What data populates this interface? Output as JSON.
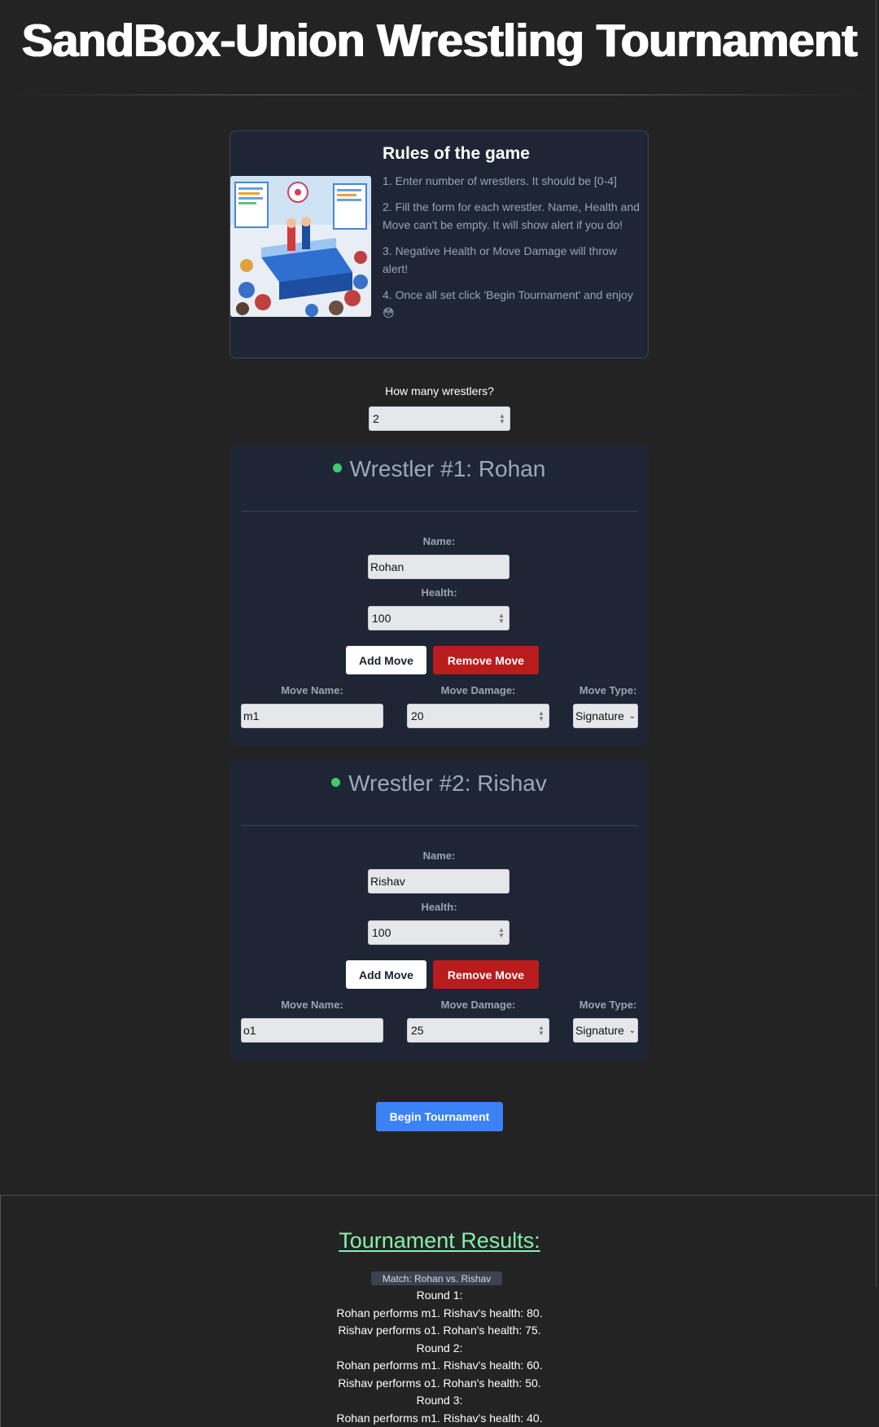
{
  "header": {
    "title": "SandBox-Union Wrestling Tournament"
  },
  "rules": {
    "title": "Rules of the game",
    "items": [
      "1. Enter number of wrestlers. It should be [0-4]",
      "2. Fill the form for each wrestler. Name, Health and Move can't be empty. It will show alert if you do!",
      "3. Negative Health or Move Damage will throw alert!",
      "4. Once all set click 'Begin Tournament' and enjoy 😳"
    ],
    "image_icon": "wrestling-ring-illustration"
  },
  "count": {
    "label": "How many wrestlers?",
    "value": "2"
  },
  "labels": {
    "name": "Name:",
    "health": "Health:",
    "add_move": "Add Move",
    "remove_move": "Remove Move",
    "move_name": "Move Name:",
    "move_damage": "Move Damage:",
    "move_type": "Move Type:"
  },
  "wrestlers": [
    {
      "title": "Wrestler #1: Rohan",
      "name": "Rohan",
      "health": "100",
      "move_name": "m1",
      "move_damage": "20",
      "move_type": "Signature"
    },
    {
      "title": "Wrestler #2: Rishav",
      "name": "Rishav",
      "health": "100",
      "move_name": "o1",
      "move_damage": "25",
      "move_type": "Signature"
    }
  ],
  "begin_label": "Begin Tournament",
  "results": {
    "title": "Tournament Results:",
    "match": "Match: Rohan vs. Rishav",
    "lines": [
      "Round 1:",
      "Rohan performs m1. Rishav's health: 80.",
      "Rishav performs o1. Rohan's health: 75.",
      "Round 2:",
      "Rohan performs m1. Rishav's health: 60.",
      "Rishav performs o1. Rohan's health: 50.",
      "Round 3:",
      "Rohan performs m1. Rishav's health: 40."
    ]
  },
  "colors": {
    "background": "#232323",
    "card": "#1e2635",
    "accent_blue": "#3b82f6",
    "danger_red": "#b91c1c",
    "status_green": "#3fcc6e",
    "results_green": "#86efac"
  }
}
